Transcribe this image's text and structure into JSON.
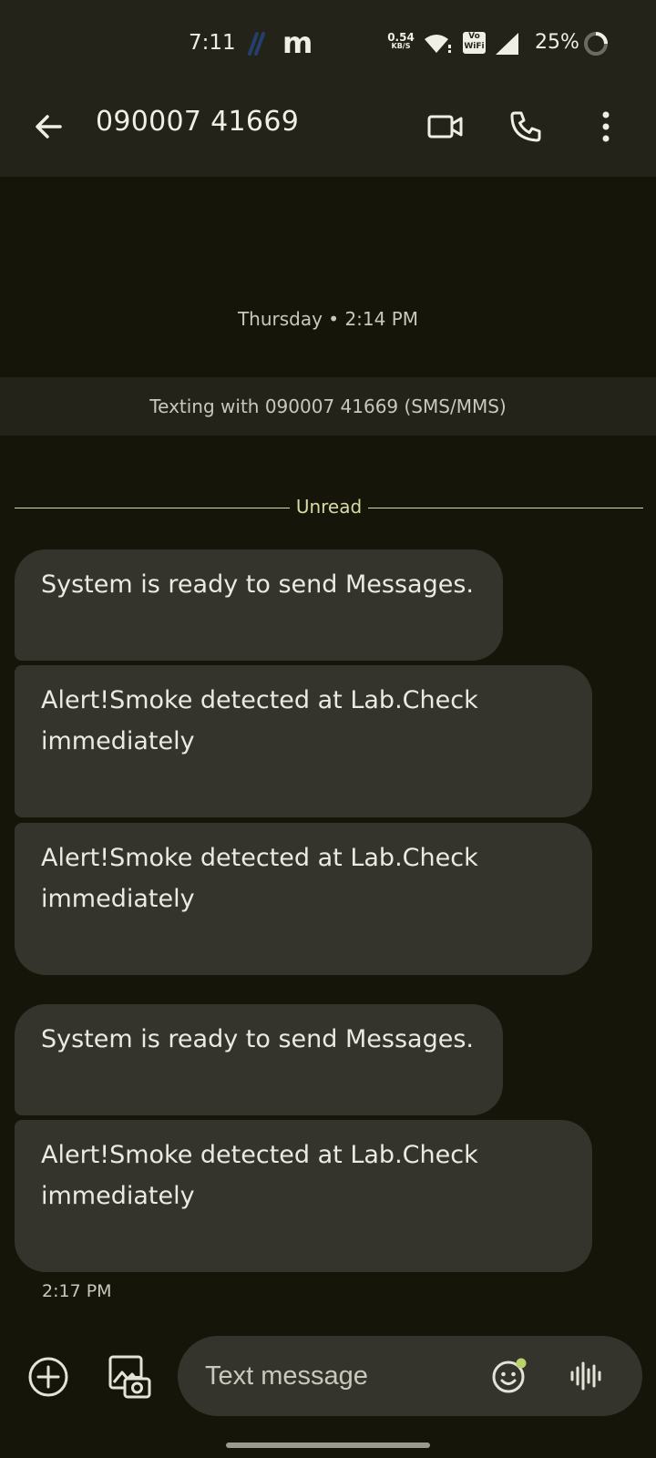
{
  "status_bar": {
    "time": "7:11",
    "net_speed_value": "0.54",
    "net_speed_unit": "KB/S",
    "vowifi_top": "Vo",
    "vowifi_bottom": "WiFi",
    "battery": "25%",
    "app_icon_letter": "m",
    "icons": [
      "nightscout-icon",
      "m-app-icon",
      "wifi-icon",
      "vowifi-icon",
      "cell-signal-icon",
      "battery-icon"
    ]
  },
  "header": {
    "title": "090007 41669",
    "icons": [
      "back-arrow-icon",
      "video-camera-icon",
      "phone-icon",
      "more-vert-icon"
    ]
  },
  "conversation": {
    "day_stamp": "Thursday • 2:14 PM",
    "texting_banner": "Texting with 090007 41669 (SMS/MMS)",
    "unread_label": "Unread",
    "messages": [
      {
        "text": "System is ready to send Messages."
      },
      {
        "text": "Alert!Smoke detected at Lab.Check immediately"
      },
      {
        "text": "Alert!Smoke detected at Lab.Check immediately"
      },
      {
        "text": "System is ready to send Messages."
      },
      {
        "text": "Alert!Smoke detected at Lab.Check immediately"
      }
    ],
    "last_timestamp": "2:17 PM"
  },
  "compose": {
    "placeholder": "Text message",
    "icons": [
      "add-circle-icon",
      "gallery-camera-icon",
      "emoji-icon",
      "voice-waveform-icon"
    ]
  },
  "colors": {
    "background": "#151509",
    "app_bar": "#232319",
    "bubble": "#34342d",
    "unread_accent": "#d9dba2"
  }
}
